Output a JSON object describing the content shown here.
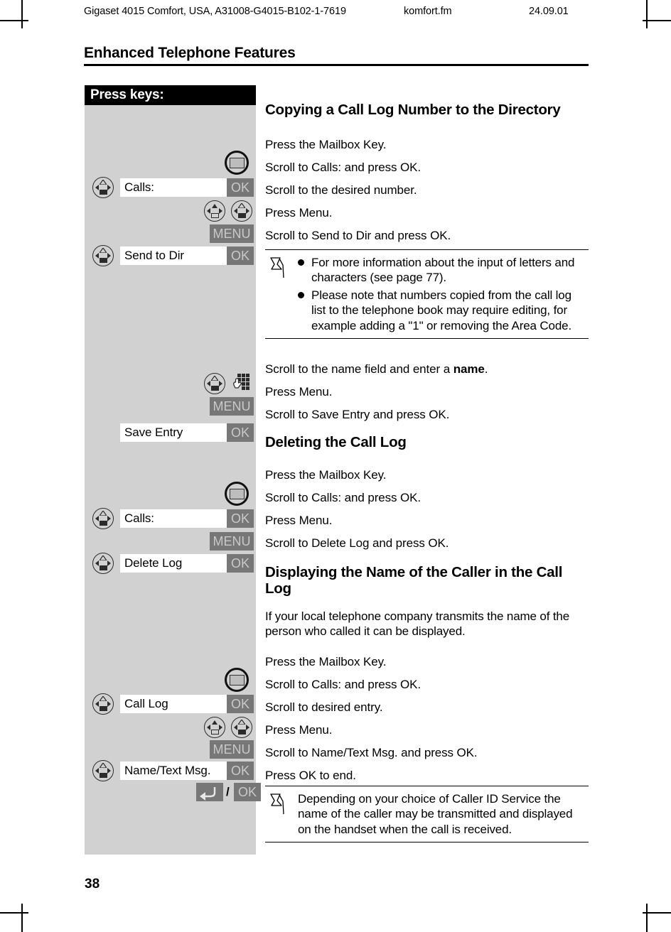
{
  "running_header": {
    "left": "Gigaset 4015 Comfort, USA, A31008-G4015-B102-1-7619",
    "middle": "komfort.fm",
    "right": "24.09.01"
  },
  "chapter_title": "Enhanced Telephone Features",
  "page_number": "38",
  "keys_panel": {
    "header": "Press keys:",
    "display_fields": {
      "calls": "Calls:",
      "send_to_dir": "Send to Dir",
      "save_entry": "Save Entry",
      "calls2": "Calls:",
      "delete_log": "Delete Log",
      "call_log": "Call Log",
      "name_text_msg": "Name/Text Msg."
    },
    "softkeys": {
      "ok": "OK",
      "menu": "MENU",
      "separator": "/"
    },
    "icon_names": {
      "mailbox": "mailbox-key-icon",
      "nav": "navigation-key-icon",
      "keypad": "keypad-entry-icon",
      "back": "back-key-icon"
    }
  },
  "sections": [
    {
      "heading": "Copying a Call Log Number to the Directory",
      "steps": [
        "Press the Mailbox Key.",
        "Scroll to Calls: and press OK.",
        "Scroll to the desired number.",
        "Press Menu.",
        "Scroll to Send to Dir and press OK."
      ]
    },
    {
      "heading": "Deleting the Call Log",
      "steps": [
        "Press the Mailbox Key.",
        "Scroll to Calls: and press OK.",
        "Press Menu.",
        "Scroll to Delete Log and press OK."
      ]
    },
    {
      "heading": "Displaying the Name of the Caller in the Call Log",
      "intro": "If your local telephone company transmits the name of the person who called it can be displayed.",
      "steps": [
        "Press the Mailbox Key.",
        "Scroll to Calls: and press OK.",
        "Scroll to desired entry.",
        "Press Menu.",
        "Scroll to Name/Text Msg. and press OK.",
        "Press OK to end."
      ]
    }
  ],
  "mid_steps": {
    "name_field_prefix": "Scroll to the name field and enter a ",
    "name_field_bold": "name",
    "name_field_suffix": ".",
    "press_menu": "Press Menu.",
    "save_entry": "Scroll to Save Entry and press OK."
  },
  "note_top": {
    "bullets": [
      "For more information about the input of letters and characters (see page 77).",
      "Please note that numbers copied from the call log list to the telephone book may require editing, for example adding a \"1\" or removing the Area Code."
    ]
  },
  "note_bottom": {
    "text": "Depending on your choice of Caller ID Service the name of the caller may be transmitted and displayed on the handset when the call is received."
  }
}
